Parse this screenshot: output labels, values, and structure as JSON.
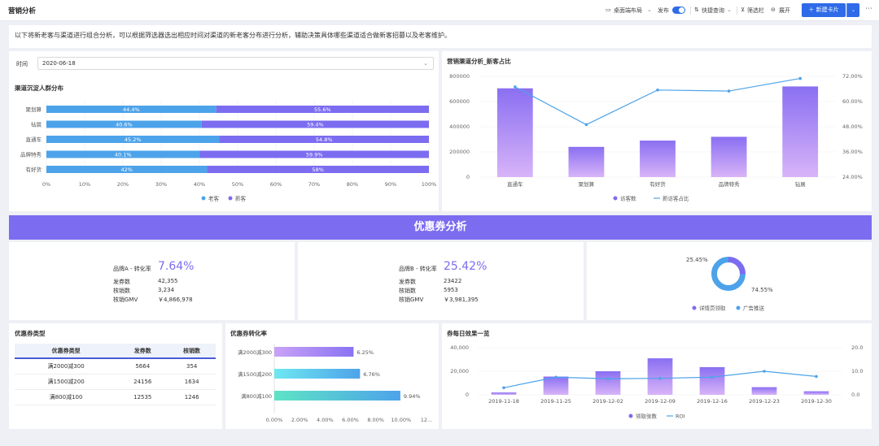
{
  "header": {
    "title": "营销分析",
    "desktop_layout": "桌面端布局",
    "publish": "发布",
    "quick_query": "快捷查询",
    "filter_bar": "筛选栏",
    "expand": "展开",
    "new_card": "新建卡片"
  },
  "description": "以下将新老客与渠道进行组合分析，可以根据筛选器选出相应时间对渠道的新老客分布进行分析，辅助决策具体哪些渠道适合做新客招募以及老客维护。",
  "filter": {
    "label": "时间",
    "value": "2020-06-18"
  },
  "colors": {
    "blue": "#4da3ea",
    "purple": "#7b6cf0",
    "line": "#4da3ea",
    "teal": "#57d9c8",
    "cyan": "#6fe0ef",
    "lilac": "#c9a3f7"
  },
  "channel_dist": {
    "title": "渠道沉淀人群分布",
    "chart_data": {
      "type": "bar",
      "categories": [
        "聚划算",
        "钻展",
        "直通车",
        "品牌特秀",
        "有好货"
      ],
      "series": [
        {
          "name": "老客",
          "values": [
            44.4,
            40.6,
            45.2,
            40.1,
            42
          ]
        },
        {
          "name": "新客",
          "values": [
            55.6,
            59.4,
            54.8,
            59.9,
            58
          ]
        }
      ],
      "labels_old": [
        "44.4%",
        "40.6%",
        "45.2%",
        "40.1%",
        "42%"
      ],
      "labels_new": [
        "55.6%",
        "59.4%",
        "54.8%",
        "59.9%",
        "58%"
      ],
      "xticks": [
        "0%",
        "10%",
        "20%",
        "30%",
        "40%",
        "50%",
        "60%",
        "70%",
        "80%",
        "90%",
        "100%"
      ],
      "xlim": [
        0,
        100
      ]
    }
  },
  "channel_ratio": {
    "title": "营销渠道分析_新客占比",
    "chart_data": {
      "type": "bar",
      "categories": [
        "直通车",
        "聚划算",
        "有好货",
        "品牌特秀",
        "钻展"
      ],
      "series": [
        {
          "name": "访客数",
          "values": [
            705000,
            240000,
            290000,
            320000,
            720000
          ]
        },
        {
          "name": "新访客占比",
          "values": [
            0.67,
            0.49,
            0.655,
            0.65,
            0.71
          ]
        }
      ],
      "yticks_left": [
        "800000",
        "600000",
        "400000",
        "200000",
        "0"
      ],
      "yticks_right": [
        "72.00%",
        "60.00%",
        "48.00%",
        "36.00%",
        "24.00%"
      ],
      "ylim_left": [
        0,
        800000
      ],
      "ylim_right": [
        0.24,
        0.72
      ]
    }
  },
  "coupon_banner": "优惠券分析",
  "kpi_a": {
    "label": "品牌A - 转化率",
    "value": "7.64%",
    "rows": [
      [
        "发券数",
        "42,355"
      ],
      [
        "核销数",
        "3,234"
      ],
      [
        "核销GMV",
        "￥4,866,978"
      ]
    ]
  },
  "kpi_b": {
    "label": "品牌B - 转化率",
    "value": "25.42%",
    "rows": [
      [
        "发券数",
        "23422"
      ],
      [
        "核销数",
        "5953"
      ],
      [
        "核销GMV",
        "￥3,981,395"
      ]
    ]
  },
  "donut": {
    "chart_data": {
      "type": "pie",
      "categories": [
        "详情页领取",
        "广告推送"
      ],
      "values": [
        25.45,
        74.55
      ],
      "labels": [
        "25.45%",
        "74.55%"
      ]
    }
  },
  "coupon_types": {
    "title": "优惠券类型",
    "columns": [
      "优惠券类型",
      "发券数",
      "核销数"
    ],
    "rows": [
      [
        "满2000减300",
        "5664",
        "354"
      ],
      [
        "满1500减200",
        "24156",
        "1634"
      ],
      [
        "满800减100",
        "12535",
        "1246"
      ]
    ]
  },
  "coupon_conv": {
    "title": "优惠券转化率",
    "chart_data": {
      "type": "bar",
      "categories": [
        "满2000减300",
        "满1500减200",
        "满800减100"
      ],
      "values": [
        6.25,
        6.76,
        9.94
      ],
      "labels": [
        "6.25%",
        "6.76%",
        "9.94%"
      ],
      "xticks": [
        "0.00%",
        "2.00%",
        "4.00%",
        "6.00%",
        "8.00%",
        "10.00%",
        "12..."
      ],
      "xlim": [
        0,
        12
      ]
    }
  },
  "daily": {
    "title": "券每日效果一览",
    "chart_data": {
      "type": "bar",
      "categories": [
        "2019-11-18",
        "2019-11-25",
        "2019-12-02",
        "2019-12-09",
        "2019-12-16",
        "2019-12-23",
        "2019-12-30"
      ],
      "series": [
        {
          "name": "领取张数",
          "values": [
            2000,
            15500,
            20000,
            31000,
            23500,
            6500,
            3000
          ]
        },
        {
          "name": "ROI",
          "values": [
            3,
            7.5,
            6.8,
            7,
            7.5,
            10,
            7.8
          ]
        }
      ],
      "yticks_left": [
        "40,000",
        "20,000",
        "0"
      ],
      "yticks_right": [
        "20.0",
        "10.0",
        "0.0"
      ],
      "ylim_left": [
        0,
        40000
      ],
      "ylim_right": [
        0,
        20
      ]
    }
  }
}
